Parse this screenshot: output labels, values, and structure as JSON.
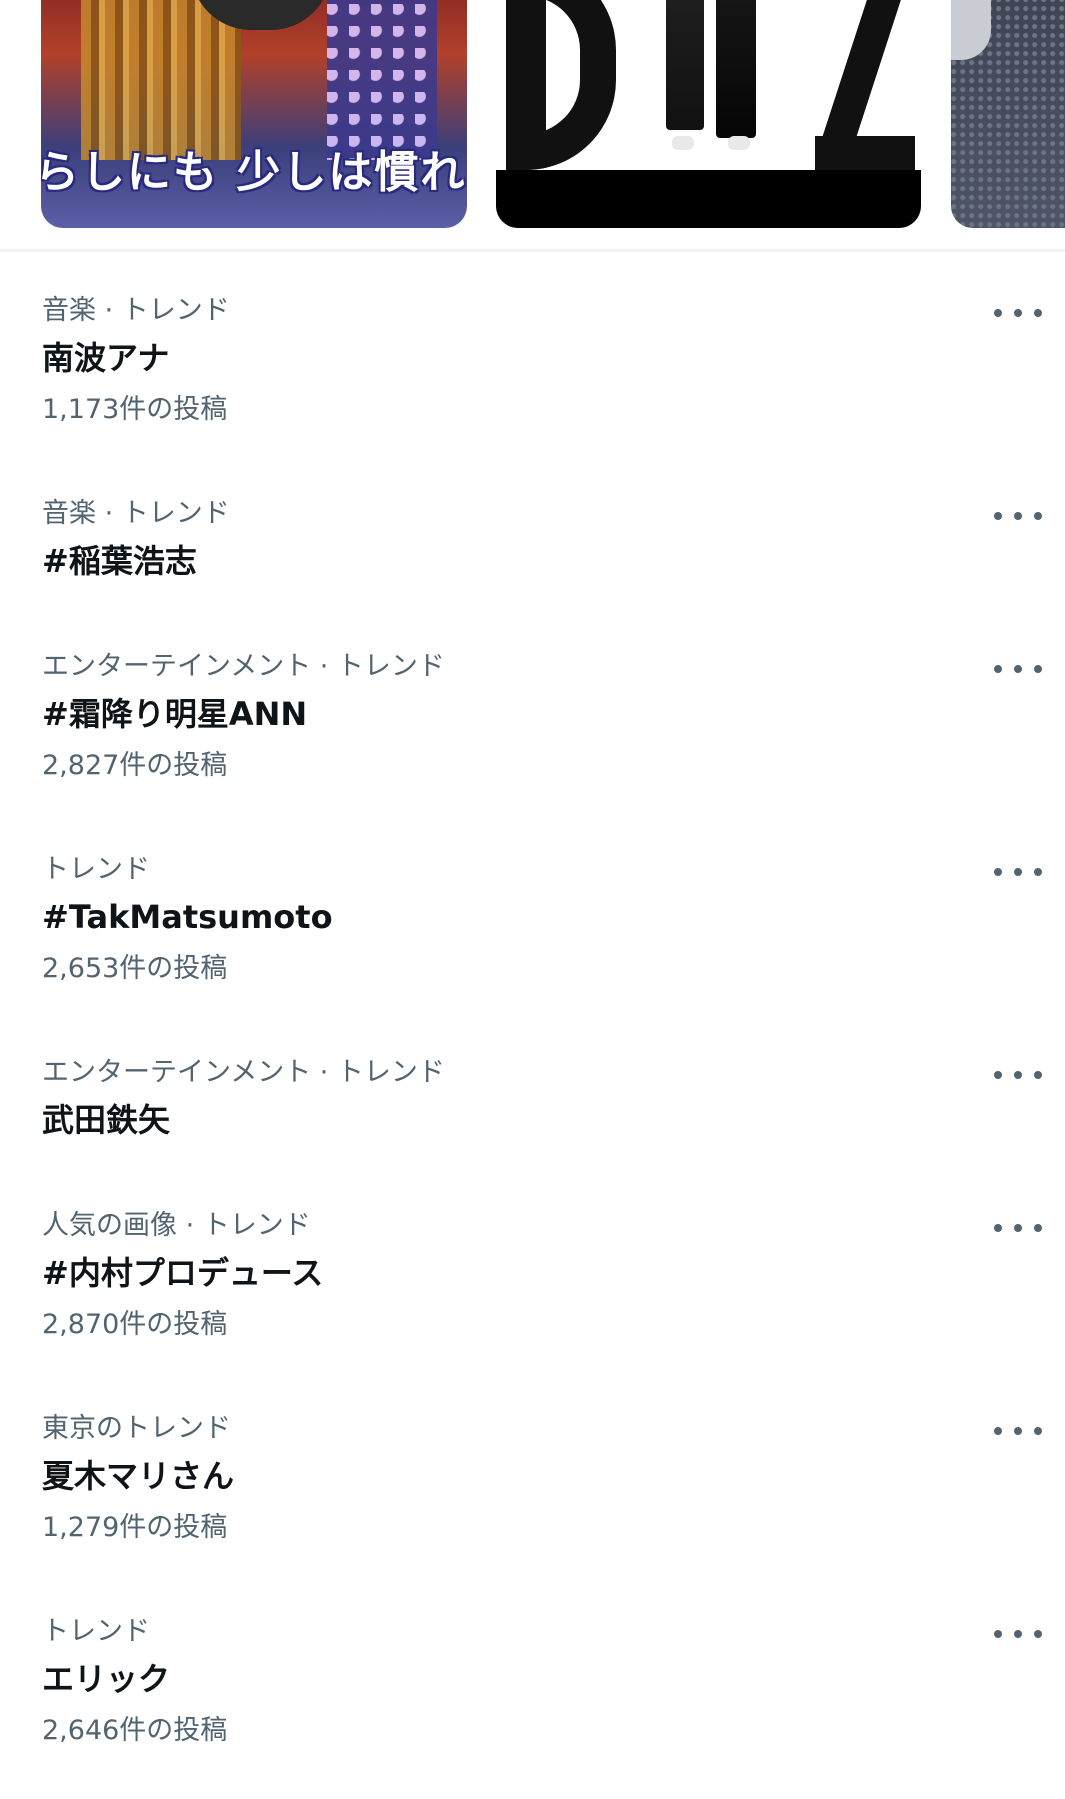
{
  "carousel": {
    "items": [
      {
        "caption": "らしにも 少しは慣れ"
      },
      {
        "caption": ""
      },
      {
        "caption": ""
      }
    ]
  },
  "trends": [
    {
      "meta": "音楽 · トレンド",
      "name": "南波アナ",
      "count": "1,173件の投稿"
    },
    {
      "meta": "音楽 · トレンド",
      "name": "#稲葉浩志",
      "count": ""
    },
    {
      "meta": "エンターテインメント · トレンド",
      "name": "#霜降り明星ANN",
      "count": "2,827件の投稿"
    },
    {
      "meta": "トレンド",
      "name": "#TakMatsumoto",
      "count": "2,653件の投稿"
    },
    {
      "meta": "エンターテインメント · トレンド",
      "name": "武田鉄矢",
      "count": ""
    },
    {
      "meta": "人気の画像 · トレンド",
      "name": "#内村プロデュース",
      "count": "2,870件の投稿"
    },
    {
      "meta": "東京のトレンド",
      "name": "夏木マリさん",
      "count": "1,279件の投稿"
    },
    {
      "meta": "トレンド",
      "name": "エリック",
      "count": "2,646件の投稿"
    }
  ],
  "icons": {
    "more": "more-horizontal-icon"
  },
  "colors": {
    "primary_text": "#0f1419",
    "secondary_text": "#536471",
    "divider": "#eff3f4"
  }
}
